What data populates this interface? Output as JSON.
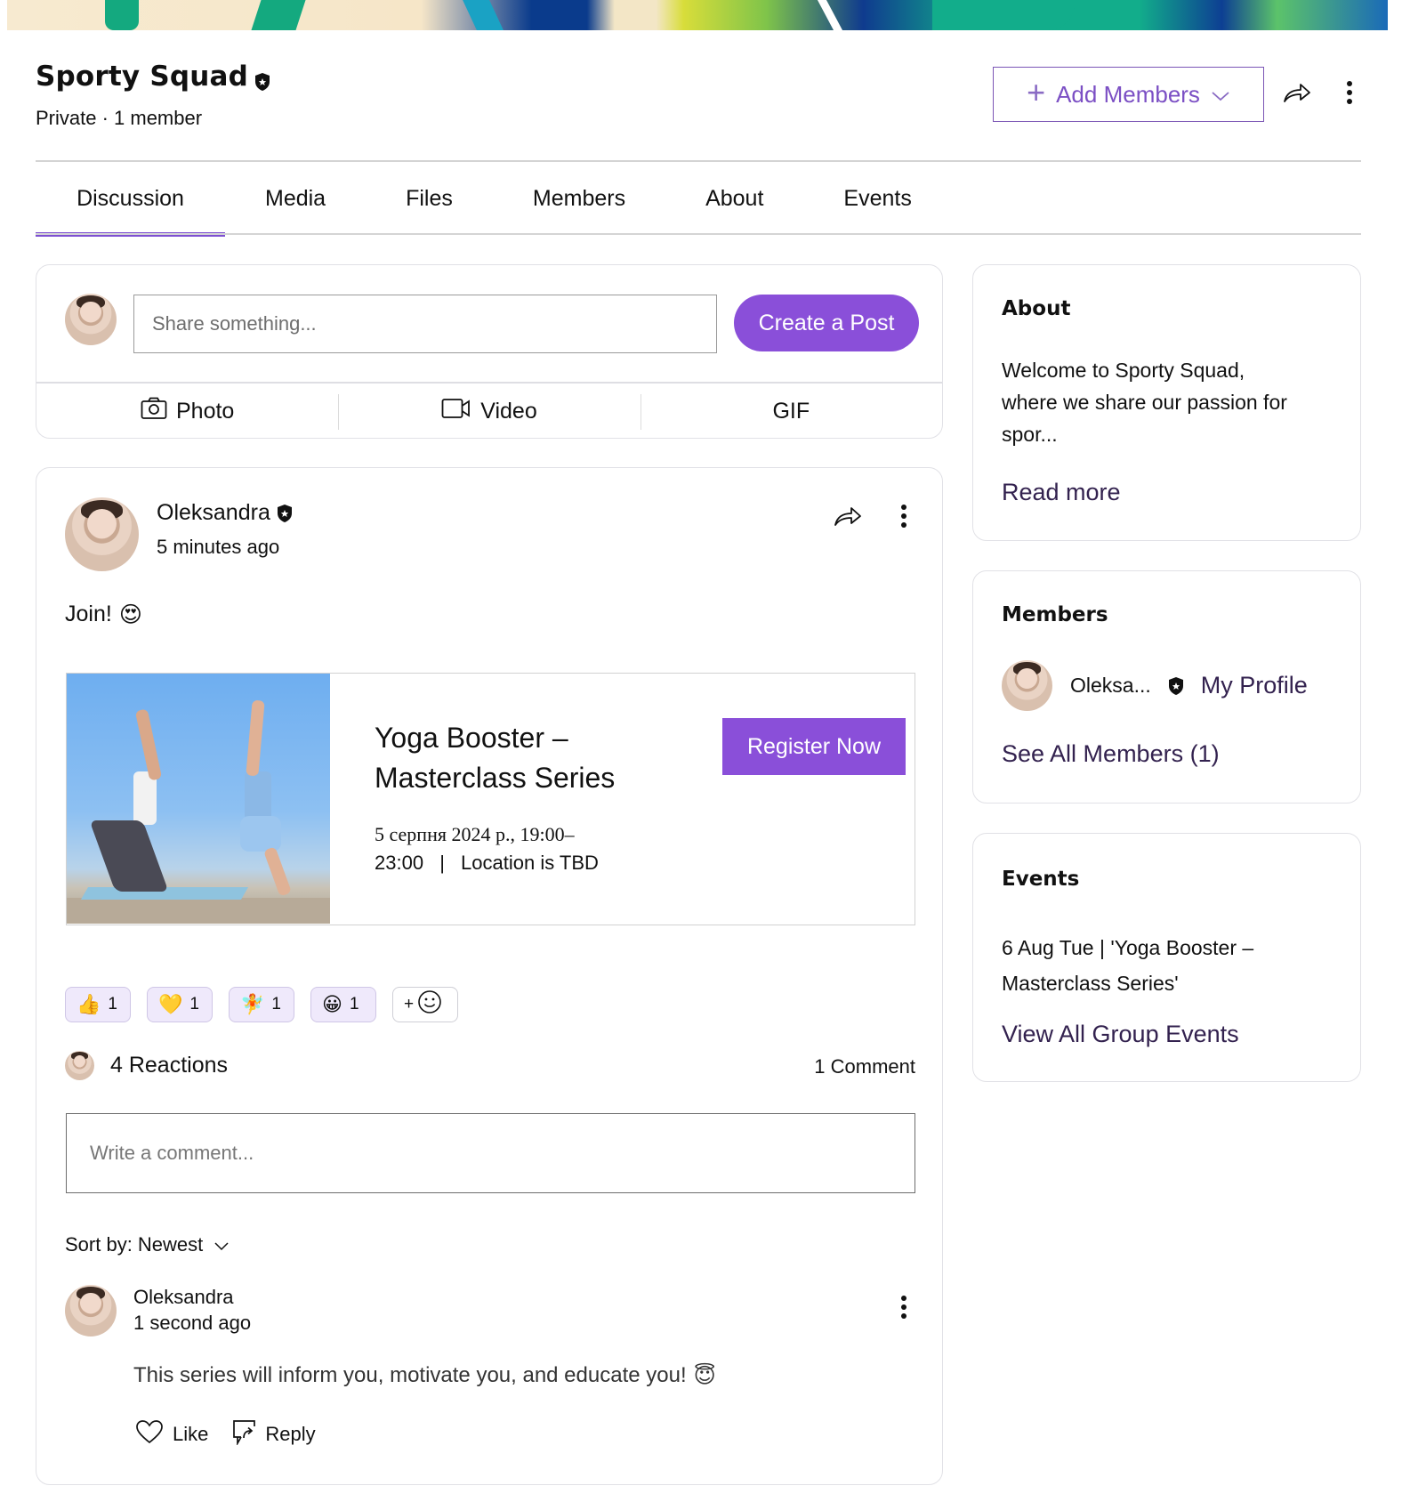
{
  "banner": {
    "colors": [
      "#f7ead0",
      "#12ad8b",
      "#0a3b8c",
      "#7fc44a",
      "#d8dd3a"
    ]
  },
  "header": {
    "title": "Sporty Squad",
    "subtitle": "Private · 1 member",
    "add_members_label": "Add Members",
    "admin_badge_icon": "shield-star-icon",
    "share_icon": "share-arrow-icon",
    "more_icon": "kebab-icon"
  },
  "tabs": [
    {
      "label": "Discussion",
      "active": true
    },
    {
      "label": "Media"
    },
    {
      "label": "Files"
    },
    {
      "label": "Members"
    },
    {
      "label": "About"
    },
    {
      "label": "Events"
    }
  ],
  "composer": {
    "placeholder": "Share something...",
    "create_post_label": "Create a Post",
    "actions": [
      {
        "label": "Photo",
        "icon": "camera-icon"
      },
      {
        "label": "Video",
        "icon": "video-icon"
      },
      {
        "label": "GIF"
      }
    ]
  },
  "post": {
    "author": "Oleksandra",
    "time": "5 minutes ago",
    "text": "Join!",
    "text_emoji": "😍",
    "event": {
      "title_line1": "Yoga Booster –",
      "title_line2": "Masterclass Series",
      "date_line1": "5 серпня 2024 р., 19:00–",
      "date_line2": "23:00",
      "separator": "|",
      "location": "Location is TBD",
      "register_label": "Register Now"
    },
    "reactions": [
      {
        "emoji": "👍",
        "count": "1"
      },
      {
        "emoji": "💛",
        "count": "1"
      },
      {
        "emoji": "🧚",
        "count": "1"
      },
      {
        "emoji": "😀",
        "count": "1"
      }
    ],
    "add_reaction_label": "+",
    "reactions_summary": "4 Reactions",
    "comment_count": "1 Comment",
    "comment_placeholder": "Write a comment...",
    "sort_label": "Sort by: Newest",
    "comments": [
      {
        "author": "Oleksandra",
        "time": "1 second ago",
        "text": "This series will inform you, motivate you, and educate you!",
        "text_emoji": "😇",
        "like_label": "Like",
        "reply_label": "Reply"
      }
    ]
  },
  "sidebar": {
    "about": {
      "title": "About",
      "text_line1": "Welcome to Sporty Squad,",
      "text_line2": "where we share our passion for",
      "text_line3": "spor...",
      "read_more": "Read more"
    },
    "members": {
      "title": "Members",
      "member_name": "Oleksa...",
      "my_profile": "My Profile",
      "see_all": "See All Members (1)"
    },
    "events": {
      "title": "Events",
      "event_line1": "6 Aug Tue | 'Yoga Booster –",
      "event_line2": "Masterclass Series'",
      "view_all": "View All Group Events"
    }
  },
  "colors": {
    "accent": "#8a4fd9",
    "tab_underline": "#7d4fd1",
    "link": "#33224f",
    "reaction_bg": "#efe9fb"
  }
}
